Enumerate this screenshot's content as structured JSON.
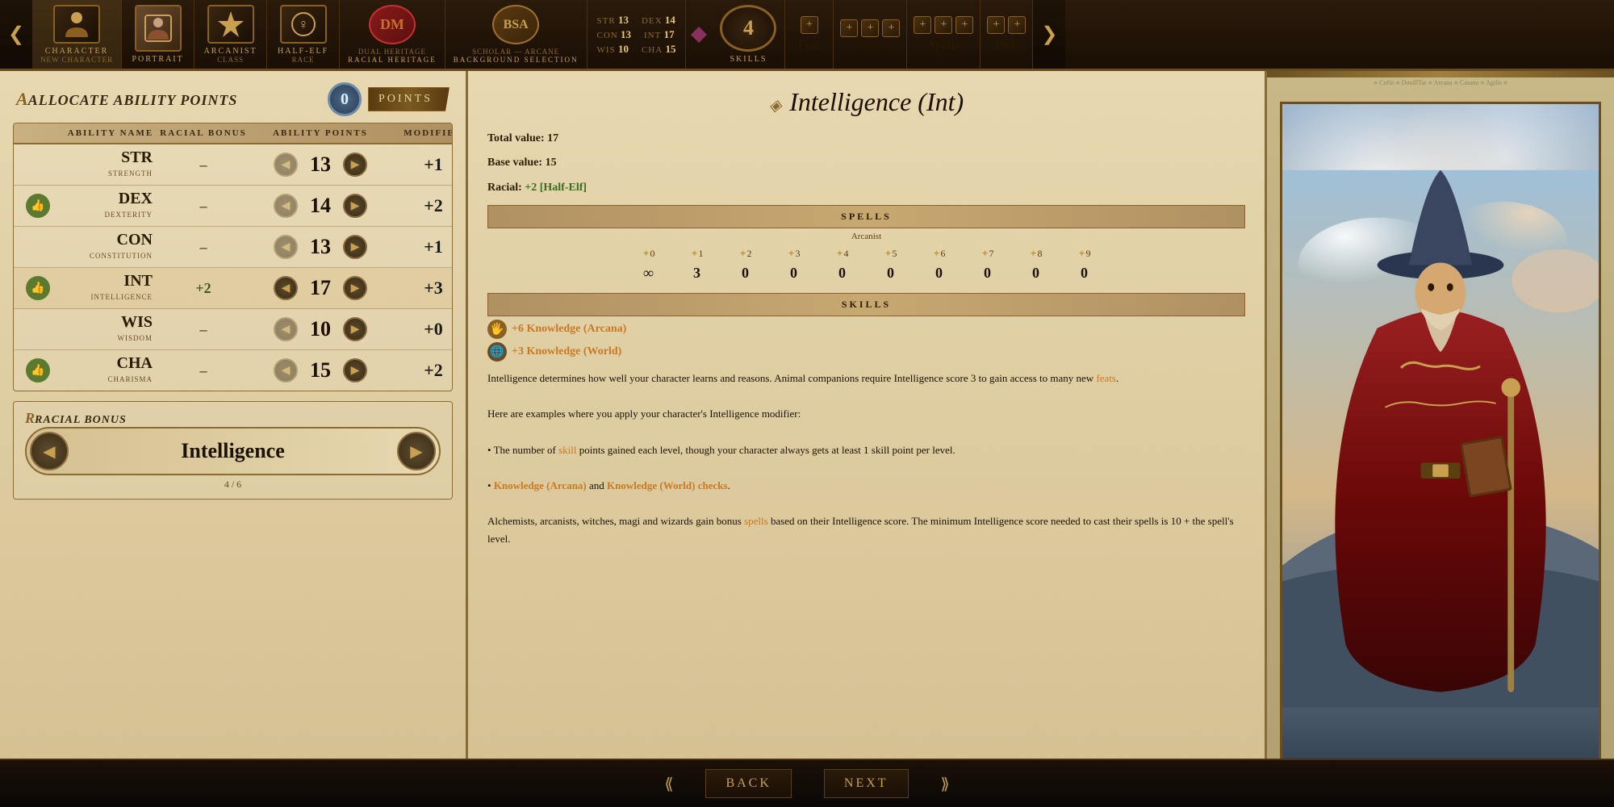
{
  "nav": {
    "left_arrow": "❮",
    "right_arrow": "❯",
    "items": [
      {
        "id": "character",
        "icon": "👤",
        "label": "Character",
        "sublabel": "New Character",
        "active": true
      },
      {
        "id": "portrait",
        "icon": "🎨",
        "label": "Portrait",
        "sublabel": "",
        "active": false
      },
      {
        "id": "class",
        "icon": "⚔",
        "label": "Class",
        "sublabel": "Arcanist",
        "active": false
      },
      {
        "id": "race",
        "icon": "♀",
        "label": "Race",
        "sublabel": "Half-Elf",
        "active": false
      },
      {
        "id": "racial_heritage",
        "icon": "DM",
        "label": "Racial Heritage",
        "sublabel": "Dual Heritage",
        "active": false
      },
      {
        "id": "background",
        "icon": "BSA",
        "label": "Background Selection",
        "sublabel": "Scholar — Arcane",
        "active": false
      }
    ],
    "stats": {
      "str_label": "STR",
      "str_val": "13",
      "dex_label": "DEX",
      "dex_val": "14",
      "con_label": "CON",
      "con_val": "13",
      "int_label": "INT",
      "int_val": "17",
      "wis_label": "WIS",
      "wis_val": "10",
      "cha_label": "CHA",
      "cha_val": "15"
    },
    "skills_count": "4",
    "skills_label": "Skills",
    "feat_label": "Feat",
    "exploits_label": "Arcanist Exploits",
    "spells_label": "Spells",
    "deft_label": "Deft"
  },
  "allocate": {
    "title": "Allocate Ability Points",
    "points": "0",
    "points_label": "Points",
    "col_ability": "Ability Name",
    "col_racial": "Racial Bonus",
    "col_points": "Ability Points",
    "col_modifier": "Modifier",
    "abilities": [
      {
        "abbrev": "STR",
        "full": "Strength",
        "racial": "–",
        "value": "13",
        "modifier": "+1",
        "highlighted": false,
        "has_thumb": false
      },
      {
        "abbrev": "DEX",
        "full": "Dexterity",
        "racial": "–",
        "value": "14",
        "modifier": "+2",
        "highlighted": false,
        "has_thumb": true
      },
      {
        "abbrev": "CON",
        "full": "Constitution",
        "racial": "–",
        "value": "13",
        "modifier": "+1",
        "highlighted": false,
        "has_thumb": false
      },
      {
        "abbrev": "INT",
        "full": "Intelligence",
        "racial": "+2",
        "value": "17",
        "modifier": "+3",
        "highlighted": true,
        "has_thumb": true
      },
      {
        "abbrev": "WIS",
        "full": "Wisdom",
        "racial": "–",
        "value": "10",
        "modifier": "+0",
        "highlighted": false,
        "has_thumb": false
      },
      {
        "abbrev": "CHA",
        "full": "Charisma",
        "racial": "–",
        "value": "15",
        "modifier": "+2",
        "highlighted": false,
        "has_thumb": true
      }
    ]
  },
  "racial_bonus": {
    "title": "Racial Bonus",
    "value": "Intelligence",
    "progress": "4 / 6"
  },
  "bottom": {
    "back_label": "Back",
    "next_label": "Next"
  },
  "detail": {
    "stat_name": "Intelligence (Int)",
    "total_label": "Total value:",
    "total_val": "17",
    "base_label": "Base value:",
    "base_val": "15",
    "racial_label": "Racial:",
    "racial_val": "+2 [Half-Elf]",
    "spells_section": "Spells",
    "spells_class": "Arcanist",
    "spell_levels": [
      "+0",
      "+1",
      "+2",
      "+3",
      "+4",
      "+5",
      "+6",
      "+7",
      "+8",
      "+9"
    ],
    "spell_symbols": [
      "✦",
      "✦",
      "✦",
      "✦",
      "✦",
      "✦",
      "✦",
      "✦",
      "✦",
      "✦"
    ],
    "spell_slots": [
      "∞",
      "3",
      "0",
      "0",
      "0",
      "0",
      "0",
      "0",
      "0",
      "0"
    ],
    "skills_section": "Skills",
    "skills": [
      {
        "icon": "🖐",
        "value": "+6",
        "name": "Knowledge (Arcana)"
      },
      {
        "icon": "🌐",
        "value": "+3",
        "name": "Knowledge (World)"
      }
    ],
    "description_parts": [
      "Intelligence determines how well your character learns and reasons. Animal companions require Intelligence score 3 to gain access to many new ",
      "feats",
      ".",
      "\n\nHere are examples where you apply your character's Intelligence modifier:",
      "\n\n• The number of ",
      "skill",
      " points gained each level, though your character always gets at least 1 skill point per level.",
      "\n\n• ",
      "Knowledge (Arcana)",
      " and ",
      "Knowledge (World)",
      " checks",
      ".",
      "\n\nAlchemists, arcanists, witches, magi and wizards gain bonus ",
      "spells",
      " based on their Intelligence score. The minimum Intelligence score needed to cast their spells is 10 + the spell's level."
    ]
  },
  "portrait": {
    "caption": "Portrait"
  }
}
